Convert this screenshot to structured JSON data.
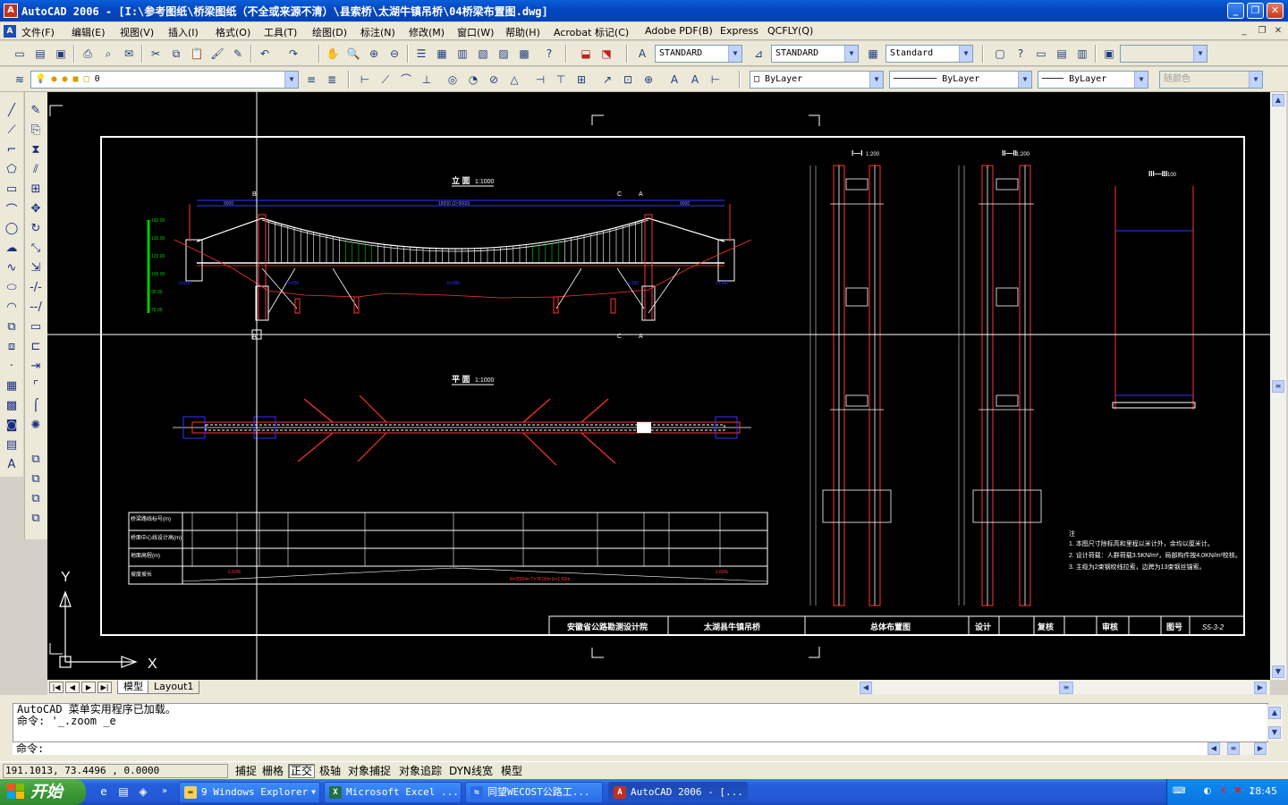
{
  "window": {
    "title": "AutoCAD 2006 - [I:\\参考图纸\\桥梁图纸（不全或来源不清）\\县索桥\\太湖牛镇吊桥\\04桥梁布置图.dwg]",
    "app_icon": "A",
    "minimize": "_",
    "restore": "❐",
    "close": "✕"
  },
  "menubar": {
    "items": [
      "文件(F)",
      "编辑(E)",
      "视图(V)",
      "插入(I)",
      "格式(O)",
      "工具(T)",
      "绘图(D)",
      "标注(N)",
      "修改(M)",
      "窗口(W)",
      "帮助(H)",
      "Acrobat 标记(C)",
      "Adobe PDF(B)",
      "Express",
      "QCFLY(Q)"
    ]
  },
  "toolbar_styles": {
    "text_style": "STANDARD",
    "dim_style": "STANDARD",
    "table_style": "Standard",
    "plot_style": ""
  },
  "toolbar_layers": {
    "current_layer": "0",
    "color": "ByLayer",
    "linetype": "ByLayer",
    "lineweight": "ByLayer",
    "plotstyle": "随颜色"
  },
  "drawing": {
    "elevation_title": "立 面",
    "elevation_scale": "1:1000",
    "plan_title": "平 面",
    "plan_scale": "1:1000",
    "section1_title": "I—I",
    "section1_scale": "1:200",
    "section2_title": "II—II",
    "section2_scale": "1:200",
    "section3_title": "III—III",
    "section3_scale": "1:100",
    "table_rows": [
      "桥梁路线标号(m)",
      "桥面中心线设计高(m)",
      "地面高程(m)",
      "坡度坡长"
    ],
    "notes_title": "注",
    "notes": [
      "1. 本图尺寸除标高和里程以米计外，余均以厘米计。",
      "2. 设计荷载：人群荷载3.5KN/m²，局部构件按4.0KN/m²校核。",
      "3. 主缆为2束钢绞线拉索，边跨为13束钢丝锚索。"
    ],
    "title_block": {
      "org": "安徽省公路勘测设计院",
      "project": "太湖县牛镇吊桥",
      "drawing_name": "总体布置图",
      "design_label": "设计",
      "review_label": "复核",
      "approve_label": "审核",
      "number_label": "图号",
      "number": "S5-3-2"
    },
    "ucs": {
      "x": "X",
      "y": "Y"
    }
  },
  "tabs": [
    "模型",
    "Layout1"
  ],
  "active_tab": "模型",
  "command": {
    "history": [
      "AutoCAD 菜单实用程序已加载。",
      "命令: '_.zoom _e"
    ],
    "prompt": "命令:"
  },
  "statusbar": {
    "coords": "191.1013, 73.4496 , 0.0000",
    "toggles": [
      {
        "label": "捕捉",
        "on": false
      },
      {
        "label": "栅格",
        "on": false
      },
      {
        "label": "正交",
        "on": true
      },
      {
        "label": "极轴",
        "on": false
      },
      {
        "label": "对象捕捉",
        "on": false
      },
      {
        "label": "对象追踪",
        "on": false
      },
      {
        "label": "DYN",
        "on": false
      },
      {
        "label": "线宽",
        "on": false
      },
      {
        "label": "模型",
        "on": false
      }
    ]
  },
  "taskbar": {
    "start": "开始",
    "tasks": [
      {
        "label": "9 Windows Explorer",
        "icon": "folder-icon"
      },
      {
        "label": "Microsoft Excel ...",
        "icon": "excel-icon"
      },
      {
        "label": "同望WECOST公路工...",
        "icon": "wecost-icon"
      },
      {
        "label": "AutoCAD 2006 - [...",
        "icon": "autocad-icon"
      }
    ],
    "clock": "18:45"
  }
}
